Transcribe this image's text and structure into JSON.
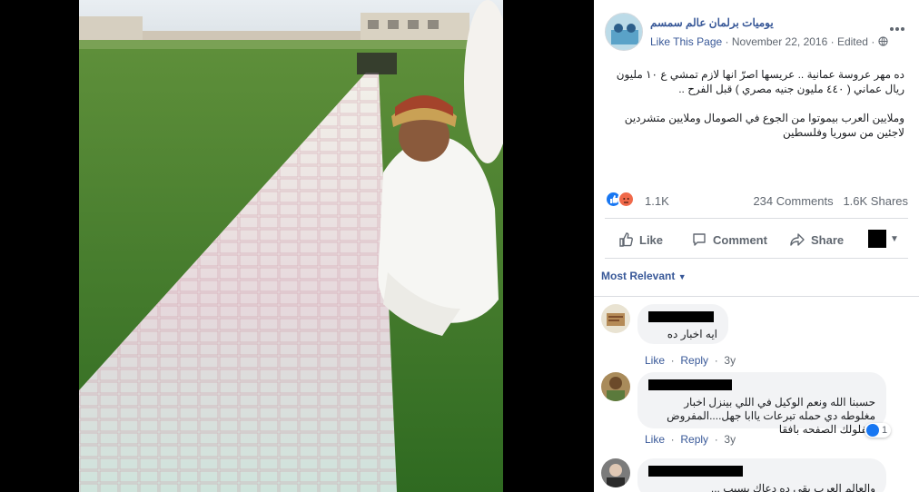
{
  "page": {
    "name": "يوميات برلمان عالم سمسم",
    "like_page": "Like This Page",
    "separator": "·",
    "date": "November 22, 2016",
    "edited": "Edited",
    "audience_icon": "globe-icon",
    "more_icon": "ellipsis-icon"
  },
  "post": {
    "paragraph1": "ده مهر عروسة عمانية .. عريسها اصرّ انها لازم تمشي ع ١٠ مليون ريال عماني ( ٤٤٠ مليون جنيه مصري ) قبل الفرح ..",
    "paragraph2": "وملايين العرب بيموتوا من الجوع في الصومال وملايين متشردين لاجئين من سوريا وفلسطين"
  },
  "stats": {
    "reactions": "1.1K",
    "comments": "234 Comments",
    "shares": "1.6K Shares"
  },
  "actions": {
    "like": "Like",
    "comment": "Comment",
    "share": "Share"
  },
  "filter": {
    "label": "Most Relevant"
  },
  "comments": [
    {
      "text": "ايه اخبار ده",
      "like": "Like",
      "reply": "Reply",
      "time": "3y"
    },
    {
      "text": "حسبنا الله ونعم الوكيل في اللي بينزل اخبار مغلوطه دي حمله تبرعات ياابا جهل....المفروض يقفلولك الصفحه بافقا",
      "like": "Like",
      "reply": "Reply",
      "time": "3y",
      "reaction_count": "1"
    },
    {
      "text": "والعالم العرب بقى ده دعاك بسبب ... "
    }
  ],
  "colors": {
    "link": "#385898",
    "meta": "#606770",
    "like_blue": "#1877f2",
    "angry_orange": "#f0694a",
    "bubble_bg": "#f2f3f5",
    "grass": "#3f7a2c"
  }
}
